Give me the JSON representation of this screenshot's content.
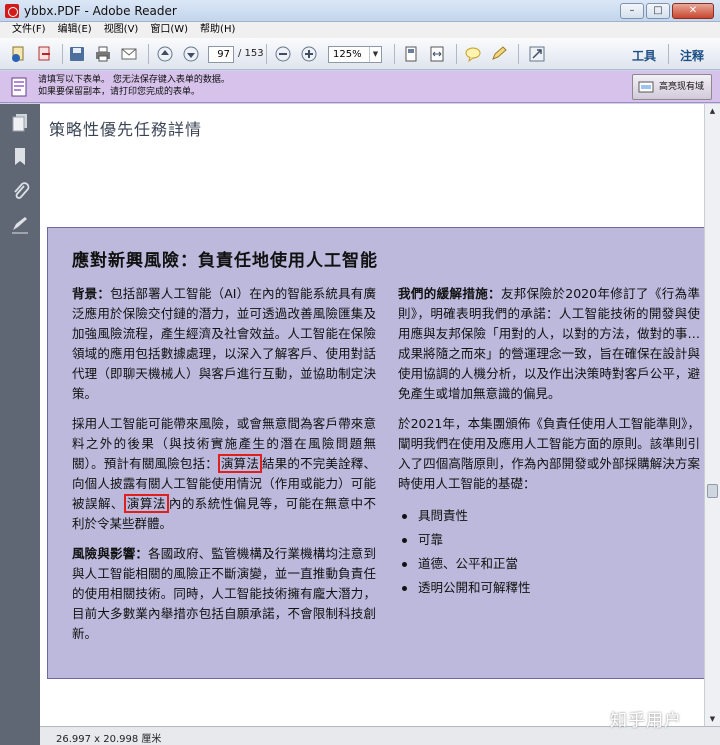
{
  "window": {
    "title": "ybbx.PDF - Adobe Reader"
  },
  "menu": [
    "文件(F)",
    "编辑(E)",
    "视图(V)",
    "窗口(W)",
    "帮助(H)"
  ],
  "toolbar": {
    "page_current": "97",
    "page_total": "/ 153",
    "zoom": "125%",
    "tools_label": "工具",
    "comment_label": "注释"
  },
  "formbar": {
    "line1": "请填写以下表单。 您无法保存键入表单的数据。",
    "line2": "如果要保留副本，请打印您完成的表单。",
    "highlight_button": "高亮现有域"
  },
  "document": {
    "heading": "策略性優先任務詳情",
    "box_title": "應對新興風險：負責任地使用人工智能",
    "left": {
      "p1_label": "背景：",
      "p1_text": "包括部署人工智能（AI）在內的智能系統具有廣泛應用於保險交付鏈的潛力，並可透過改善風險匯集及加強風險流程，產生經濟及社會效益。人工智能在保險領域的應用包括數據處理，以深入了解客戶、使用對話代理（即聊天機械人）與客戶進行互動，並協助制定決策。",
      "p2_a": "採用人工智能可能帶來風險，或會無意間為客戶帶來意料之外的後果（與技術實施產生的潛在風險問題無關）。預計有關風險包括：",
      "p2_mark1": "演算法",
      "p2_b": "結果的不完美詮釋、向個人披露有關人工智能使用情況（作用或能力）可能被誤解、",
      "p2_mark2": "演算法",
      "p2_c": "內的系統性偏見等，可能在無意中不利於令某些群體。",
      "p3_label": "風險與影響：",
      "p3_text": "各國政府、監管機構及行業機構均注意到與人工智能相關的風險正不斷演變，並一直推動負責任的使用相關技術。同時，人工智能技術擁有龐大潛力，目前大多數業內舉措亦包括自願承諾，不會限制科技創新。"
    },
    "right": {
      "p1_label": "我們的緩解措施：",
      "p1_text": "友邦保險於2020年修訂了《行為準則》，明確表明我們的承諾：人工智能技術的開發與使用應與友邦保險「用對的人，以對的方法，做對的事…成果將隨之而來」的營運理念一致，旨在確保在設計與使用協調的人機分析，以及作出決策時對客戶公平，避免產生或增加無意識的偏見。",
      "p2_text": "於2021年，本集團頒佈《負責任使用人工智能準則》，闡明我們在使用及應用人工智能方面的原則。該準則引入了四個高階原則，作為內部開發或外部採購解決方案時使用人工智能的基礎：",
      "bullets": [
        "具問責性",
        "可靠",
        "道德、公平和正當",
        "透明公開和可解釋性"
      ]
    }
  },
  "status": {
    "dimensions": "26.997 x 20.998 厘米"
  },
  "watermark": "知乎用户"
}
